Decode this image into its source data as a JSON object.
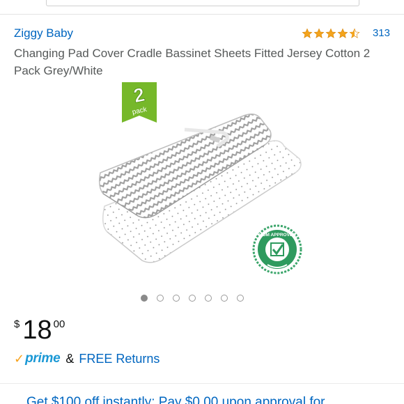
{
  "product": {
    "brand": "Ziggy Baby",
    "rating_value": 4.5,
    "rating_count": "313",
    "title": "Changing Pad Cover Cradle Bassinet Sheets Fitted Jersey Cotton 2 Pack Grey/White",
    "image": {
      "badge_number": "2",
      "badge_word": "pack",
      "seal_text": "MOM APPROVED"
    }
  },
  "carousel": {
    "total": 7,
    "active_index": 0
  },
  "price": {
    "currency": "$",
    "whole": "18",
    "fraction": "00"
  },
  "shipping": {
    "prime_check": "✓",
    "prime_word": "prime",
    "ampersand": "&",
    "returns_label": "FREE Returns"
  },
  "offer": {
    "text": "Get $100 off instantly: Pay $0.00 upon approval for"
  },
  "colors": {
    "link": "#0066c0",
    "star": "#f4a41c",
    "prime_blue": "#1a98d5",
    "prime_check": "#f7a21c",
    "badge_green": "#76b82a"
  },
  "icons": {
    "star": "star-icon",
    "half_star": "half-star-icon",
    "dot": "carousel-dot-icon"
  }
}
